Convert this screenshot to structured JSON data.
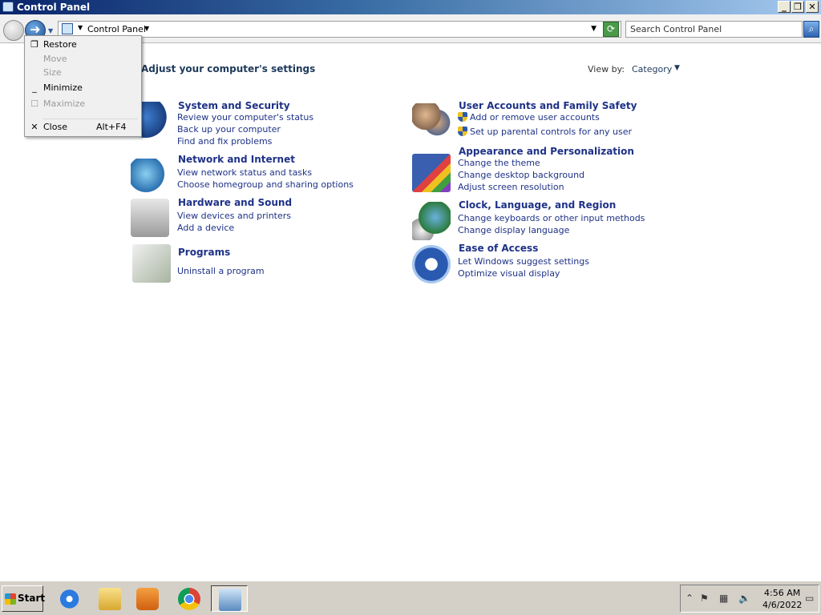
{
  "window": {
    "title": "Control Panel"
  },
  "address": {
    "crumb": "Control Panel",
    "search_placeholder": "Search Control Panel"
  },
  "main": {
    "title": "Adjust your computer's settings",
    "view_by_label": "View by:",
    "view_by_value": "Category"
  },
  "categories": [
    {
      "title": "System and Security",
      "links": [
        "Review your computer's status",
        "Back up your computer",
        "Find and fix problems"
      ]
    },
    {
      "title": "Network and Internet",
      "links": [
        "View network status and tasks",
        "Choose homegroup and sharing options"
      ]
    },
    {
      "title": "Hardware and Sound",
      "links": [
        "View devices and printers",
        "Add a device"
      ]
    },
    {
      "title": "Programs",
      "links": [
        "Uninstall a program"
      ]
    },
    {
      "title": "User Accounts and Family Safety",
      "links": [
        "Add or remove user accounts",
        "Set up parental controls for any user"
      ]
    },
    {
      "title": "Appearance and Personalization",
      "links": [
        "Change the theme",
        "Change desktop background",
        "Adjust screen resolution"
      ]
    },
    {
      "title": "Clock, Language, and Region",
      "links": [
        "Change keyboards or other input methods",
        "Change display language"
      ]
    },
    {
      "title": "Ease of Access",
      "links": [
        "Let Windows suggest settings",
        "Optimize visual display"
      ]
    }
  ],
  "system_menu": {
    "items": [
      {
        "label": "Restore",
        "enabled": true
      },
      {
        "label": "Move",
        "enabled": false
      },
      {
        "label": "Size",
        "enabled": false
      },
      {
        "label": "Minimize",
        "enabled": true
      },
      {
        "label": "Maximize",
        "enabled": false
      },
      {
        "label": "Close",
        "shortcut": "Alt+F4",
        "enabled": true
      }
    ]
  },
  "taskbar": {
    "start_label": "Start",
    "apps": [
      "internet-explorer-icon",
      "folder-icon",
      "media-player-icon",
      "chrome-icon",
      "control-panel-icon"
    ],
    "time": "4:56 AM",
    "date": "4/6/2022"
  },
  "colors": {
    "link": "#1e3287",
    "title_dark": "#1e395b",
    "taskbar": "#d4d0c8"
  }
}
